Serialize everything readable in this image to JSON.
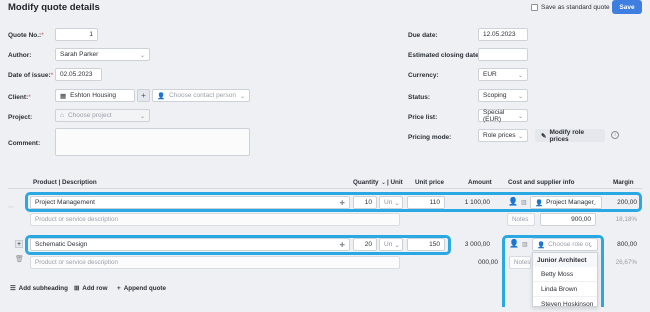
{
  "header": {
    "title": "Modify quote details",
    "standard_label": "Save as standard quote",
    "save_label": "Save"
  },
  "left": {
    "quote_no": {
      "label": "Quote No.:",
      "value": "1"
    },
    "author": {
      "label": "Author:",
      "value": "Sarah Parker"
    },
    "issue": {
      "label": "Date of issue:",
      "value": "02.05.2023"
    },
    "client": {
      "label": "Client:",
      "value": "Eshton Housing",
      "contact_placeholder": "Choose contact person"
    },
    "project": {
      "label": "Project:",
      "placeholder": "Choose project"
    },
    "comment": {
      "label": "Comment:"
    }
  },
  "right": {
    "due": {
      "label": "Due date:",
      "value": "12.05.2023"
    },
    "closing": {
      "label": "Estimated closing date:"
    },
    "currency": {
      "label": "Currency:",
      "value": "EUR"
    },
    "status": {
      "label": "Status:",
      "value": "Scoping"
    },
    "pricelist": {
      "label": "Price list:",
      "value": "Special (EUR)"
    },
    "pricing": {
      "label": "Pricing mode:",
      "value": "Role prices",
      "modify_label": "Modify role prices"
    }
  },
  "table": {
    "headers": {
      "product": "Product | Description",
      "quantity": "Quantity",
      "unit": "| Unit",
      "unit_price": "Unit price",
      "amount": "Amount",
      "cost": "Cost and supplier info",
      "margin": "Margin"
    },
    "rows": [
      {
        "product": "Project Management",
        "quantity": "10",
        "unit": "Un",
        "unit_price": "110",
        "amount": "1 100,00",
        "supplier": "Project Manager",
        "margin": "200,00",
        "desc_placeholder": "Product or service description",
        "notes": "Notes",
        "cost": "900,00",
        "margin_pct": "18,18%"
      },
      {
        "product": "Schematic Design",
        "quantity": "20",
        "unit": "Un",
        "unit_price": "150",
        "amount": "3 000,00",
        "supplier_placeholder": "Choose role or",
        "margin": "800,00",
        "desc_placeholder": "Product or service description",
        "notes": "Notes",
        "amount2": "000,00",
        "margin_pct": "26,67%"
      }
    ]
  },
  "dropdown": {
    "group": "Junior Architect",
    "items": [
      "Betty Moss",
      "Linda Brown",
      "Steven Hoskinson"
    ]
  },
  "footer": {
    "add_subheading": "Add subheading",
    "add_row": "Add row",
    "append_quote": "Append quote"
  },
  "colors": {
    "accent": "#3d7ee0",
    "highlight": "#2aa8e4"
  }
}
